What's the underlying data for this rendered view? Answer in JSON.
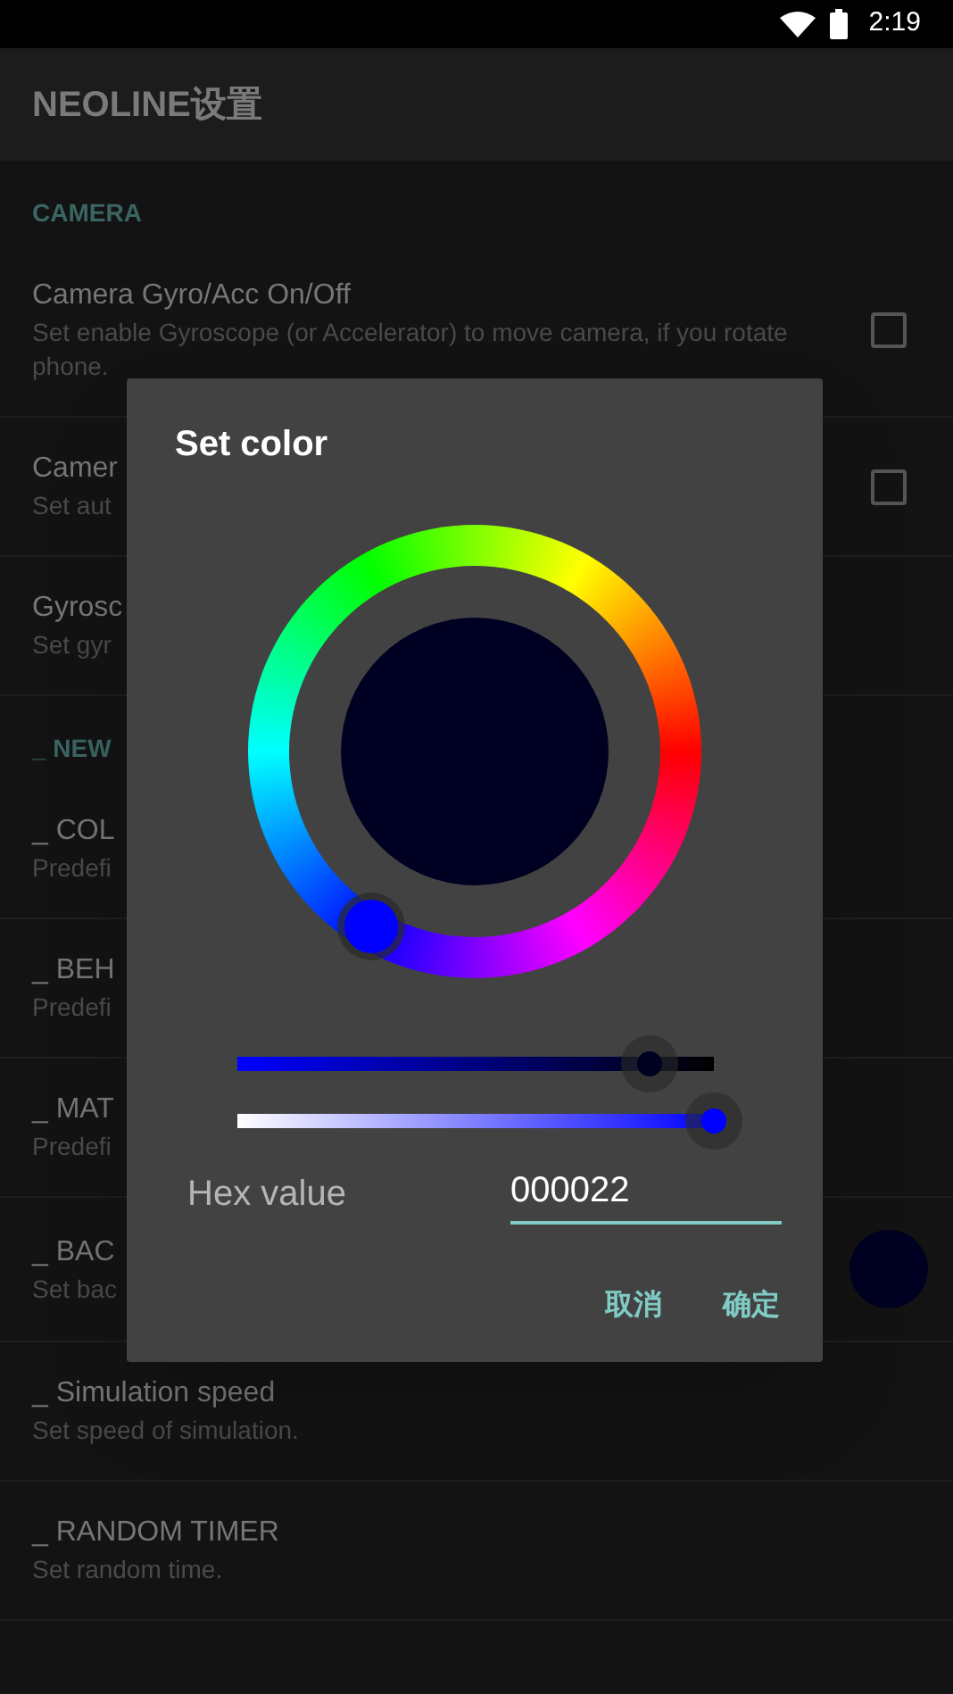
{
  "status_bar": {
    "time": "2:19"
  },
  "app_bar": {
    "title": "NEOLINE设置"
  },
  "sections": [
    {
      "header": "CAMERA",
      "items": [
        {
          "title": "Camera Gyro/Acc On/Off",
          "subtitle": "Set enable Gyroscope (or Accelerator) to move camera, if you rotate phone.",
          "kind": "checkbox",
          "checked": false
        },
        {
          "title": "Camer",
          "subtitle": "Set aut",
          "kind": "checkbox",
          "checked": false
        },
        {
          "title": "Gyrosc",
          "subtitle": "Set gyr",
          "kind": "plain"
        }
      ]
    },
    {
      "header": "_ NEW",
      "items": [
        {
          "title": "_ COL",
          "subtitle": "Predefi",
          "kind": "plain"
        },
        {
          "title": "_ BEH",
          "subtitle": "Predefi",
          "kind": "plain"
        },
        {
          "title": "_ MAT",
          "subtitle": "Predefi",
          "kind": "plain"
        },
        {
          "title": "_ BAC",
          "subtitle": "Set bac",
          "kind": "color",
          "color": "#000022"
        },
        {
          "title": "_ Simulation speed",
          "subtitle": "Set speed of simulation.",
          "kind": "plain"
        },
        {
          "title": "_ RANDOM TIMER",
          "subtitle": "Set random time.",
          "kind": "plain"
        }
      ]
    }
  ],
  "dialog": {
    "title": "Set color",
    "sliders": [
      {
        "kind": "value",
        "level": 0.865
      },
      {
        "kind": "saturation",
        "level": 1
      }
    ],
    "hex_label": "Hex value",
    "hex_value": "000022",
    "buttons": [
      "取消",
      "确定"
    ]
  }
}
